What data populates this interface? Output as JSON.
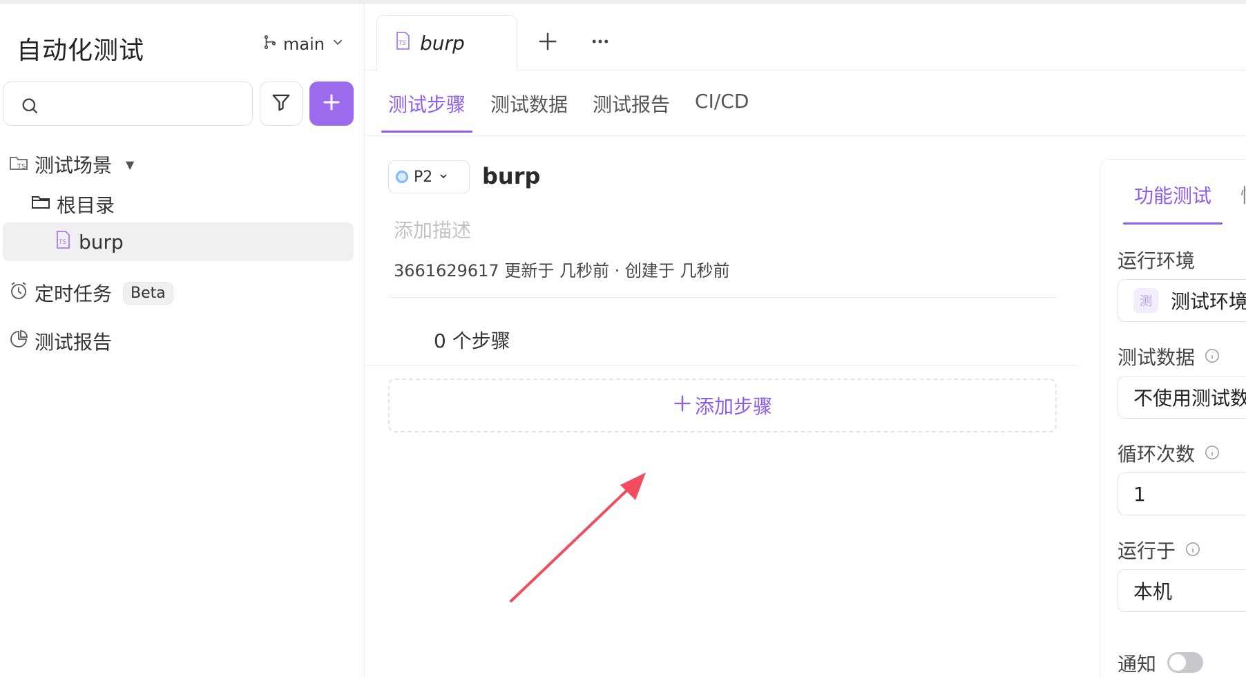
{
  "sidebar": {
    "title": "自动化测试",
    "branch": "main",
    "tree": {
      "scenes": "测试场景",
      "root": "根目录",
      "case": "burp",
      "timer": "定时任务",
      "beta": "Beta",
      "report": "测试报告"
    }
  },
  "tabs": {
    "file_tab": "burp"
  },
  "subtabs": [
    "测试步骤",
    "测试数据",
    "测试报告",
    "CI/CD"
  ],
  "case": {
    "priority": "P2",
    "title": "burp",
    "description_placeholder": "添加描述",
    "meta": "3661629617 更新于 几秒前 · 创建于 几秒前",
    "steps_count": "0 个步骤",
    "add_step": "添加步骤"
  },
  "right_panel": {
    "active_tab": "功能测试",
    "partial_tab": "性",
    "env_label": "运行环境",
    "env_badge": "测",
    "env_value": "测试环境",
    "data_label": "测试数据",
    "data_value": "不使用测试数据",
    "loop_label": "循环次数",
    "loop_value": "1",
    "run_on_label": "运行于",
    "run_on_value": "本机",
    "notify_label": "通知"
  },
  "colors": {
    "accent": "#8d5cf0",
    "add_button": "#9b6bee",
    "arrow": "#f24d5e"
  }
}
